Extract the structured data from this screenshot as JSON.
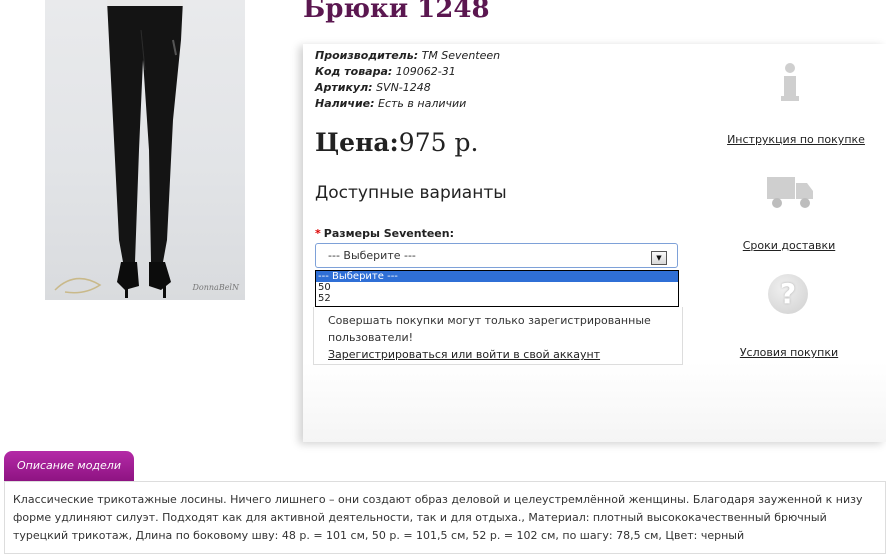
{
  "product": {
    "title": "Брюки 1248",
    "photo_signature": "DonnaBelN",
    "info": [
      {
        "label": "Производитель:",
        "value": "TM Seventeen"
      },
      {
        "label": "Код товара:",
        "value": "109062-31"
      },
      {
        "label": "Артикул:",
        "value": "SVN-1248"
      },
      {
        "label": "Наличие:",
        "value": "Есть в наличии"
      }
    ],
    "price_label": "Цена:",
    "price_value": "975 р."
  },
  "options": {
    "heading": "Доступные варианты",
    "required_mark": "*",
    "size_label": "Размеры Seventeen:",
    "select_value": "--- Выберите ---",
    "dropdown_items": [
      "--- Выберите ---",
      "50",
      "52"
    ]
  },
  "notice": {
    "text": "Совершать покупки могут только зарегистрированные пользователи!",
    "link": "Зарегистрироваться или войти в свой аккаунт"
  },
  "side": {
    "instruction_link": "Инструкция по покупке",
    "delivery_link": "Сроки доставки",
    "terms_link": "Условия покупки",
    "icons": [
      "info-icon",
      "truck-icon",
      "question-icon"
    ]
  },
  "description": {
    "tab": "Описание модели",
    "text": "Классические трикотажные лосины. Ничего лишнего – они создают образ деловой и целеустремлённой женщины. Благодаря зауженной к низу форме удлиняют силуэт. Подходят как для активной деятельности, так и для отдыха., Материал: плотный высококачественный брючный турецкий трикотаж, Длина по боковому шву: 48 р. = 101 см, 50 р. = 101,5 см, 52 р. = 102 см, по шагу: 78,5 см, Цвет: черный"
  },
  "colors": {
    "title": "#5b1750",
    "tab": "#a01e94",
    "dropdown_selected": "#2f6fd6",
    "required": "#dd0000"
  }
}
